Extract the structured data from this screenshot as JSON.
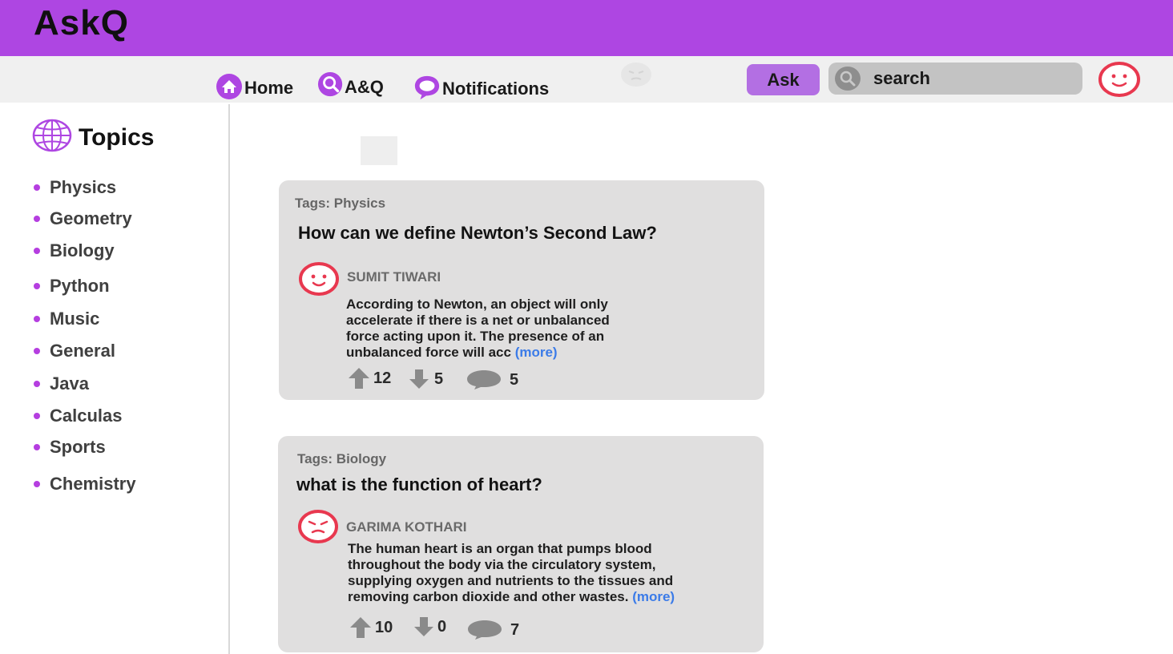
{
  "app": {
    "title": "AskQ"
  },
  "nav": {
    "items": [
      {
        "label": "Home",
        "icon": "home-icon"
      },
      {
        "label": "A&Q",
        "icon": "search-icon"
      },
      {
        "label": "Notifications",
        "icon": "chat-bubble-icon"
      }
    ]
  },
  "actions": {
    "ask_label": "Ask"
  },
  "search": {
    "placeholder": "search"
  },
  "sidebar": {
    "title": "Topics",
    "topics": [
      "Physics",
      "Geometry",
      "Biology",
      "Python",
      "Music",
      "General",
      "Java",
      "Calculas",
      "Sports",
      "Chemistry"
    ]
  },
  "feed": {
    "questions": [
      {
        "tags": "Tags: Physics",
        "title": "How can we define Newton’s Second Law?",
        "author": "SUMIT TIWARI",
        "answer_lines": [
          "According to Newton, an object will only",
          "accelerate if there is a net or unbalanced",
          "force acting upon it. The presence of an",
          "unbalanced force will acc"
        ],
        "more": "(more)",
        "upvotes": "12",
        "downvotes": "5",
        "comments": "5"
      },
      {
        "tags": "Tags: Biology",
        "title": "what is the function of  heart?",
        "author": "GARIMA KOTHARI",
        "answer_lines": [
          "The human heart is an organ that pumps blood",
          "throughout the body via the circulatory system,",
          "supplying oxygen and nutrients to the tissues and",
          "removing carbon dioxide and other wastes."
        ],
        "more": "(more)",
        "upvotes": "10",
        "downvotes": "0",
        "comments": "7"
      }
    ]
  },
  "colors": {
    "brand": "#ae46e2",
    "accent": "#b36fe3",
    "avatar": "#e8384f",
    "link": "#3b7be8",
    "card": "#e0dfdf"
  }
}
